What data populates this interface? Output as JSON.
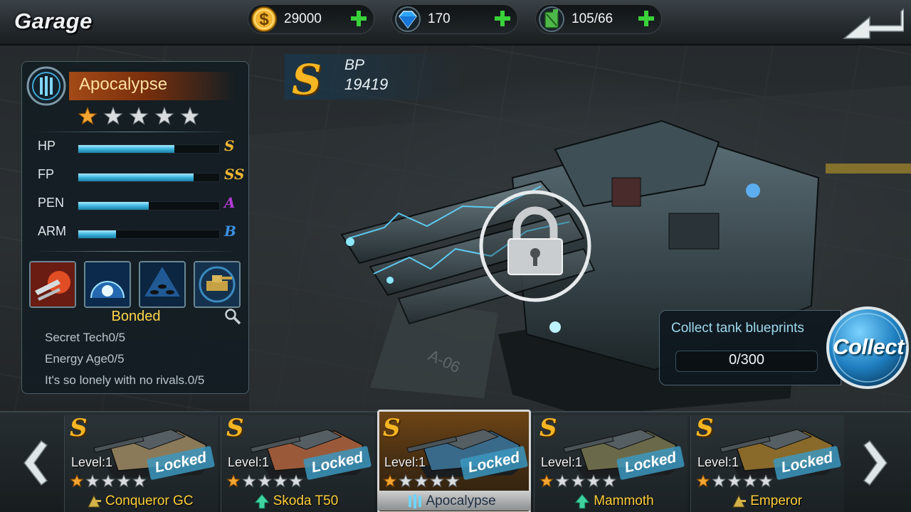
{
  "header": {
    "title": "Garage",
    "resources": [
      {
        "name": "coins",
        "icon": "dollar-coin-icon",
        "value": "29000"
      },
      {
        "name": "gems",
        "icon": "diamond-icon",
        "value": "170"
      },
      {
        "name": "fuel",
        "icon": "fuel-can-icon",
        "value": "105/66"
      }
    ],
    "back_icon": "back-arrow-icon"
  },
  "tank_panel": {
    "name": "Apocalypse",
    "stars_filled": 1,
    "stars_total": 5,
    "stats": [
      {
        "label": "HP",
        "level": 0.68,
        "grade": "S",
        "grade_color": "#f2b531"
      },
      {
        "label": "FP",
        "level": 0.82,
        "grade": "SS",
        "grade_color": "#f2b531"
      },
      {
        "label": "PEN",
        "level": 0.5,
        "grade": "A",
        "grade_color": "#b23bd6"
      },
      {
        "label": "ARM",
        "level": 0.27,
        "grade": "B",
        "grade_color": "#3b8fe0"
      }
    ],
    "skills": [
      "missile-skill-icon",
      "energy-shield-skill-icon",
      "shield-drone-skill-icon",
      "tank-upgrade-skill-icon"
    ],
    "bonded_label": "Bonded",
    "bonds": [
      "Secret Tech0/5",
      "Energy Age0/5",
      "It's so lonely with no rivals.0/5"
    ]
  },
  "bp": {
    "grade": "S",
    "label": "BP",
    "value": "19419"
  },
  "lock": {
    "icon": "padlock-icon"
  },
  "collect": {
    "title": "Collect tank blueprints",
    "progress": "0/300",
    "button_label": "Collect"
  },
  "carousel": {
    "cards": [
      {
        "grade": "S",
        "locked_label": "Locked",
        "level": "Level:1",
        "stars_filled": 1,
        "name": "Conqueror GC",
        "class_icon": "artillery-class-icon",
        "selected": false,
        "tint": "#8a7a5a"
      },
      {
        "grade": "S",
        "locked_label": "Locked",
        "level": "Level:1",
        "stars_filled": 1,
        "name": "Skoda T50",
        "class_icon": "light-tank-class-icon",
        "selected": false,
        "tint": "#9a5a3a"
      },
      {
        "grade": "S",
        "locked_label": "Locked",
        "level": "Level:1",
        "stars_filled": 1,
        "name": "Apocalypse",
        "class_icon": "heavy-tank-class-icon",
        "selected": true,
        "tint": "#3a6a8a"
      },
      {
        "grade": "S",
        "locked_label": "Locked",
        "level": "Level:1",
        "stars_filled": 1,
        "name": "Mammoth",
        "class_icon": "light-tank-class-icon",
        "selected": false,
        "tint": "#6a6a4a"
      },
      {
        "grade": "S",
        "locked_label": "Locked",
        "level": "Level:1",
        "stars_filled": 1,
        "name": "Emperor",
        "class_icon": "artillery-class-icon",
        "selected": false,
        "tint": "#8a6a2a"
      }
    ]
  }
}
